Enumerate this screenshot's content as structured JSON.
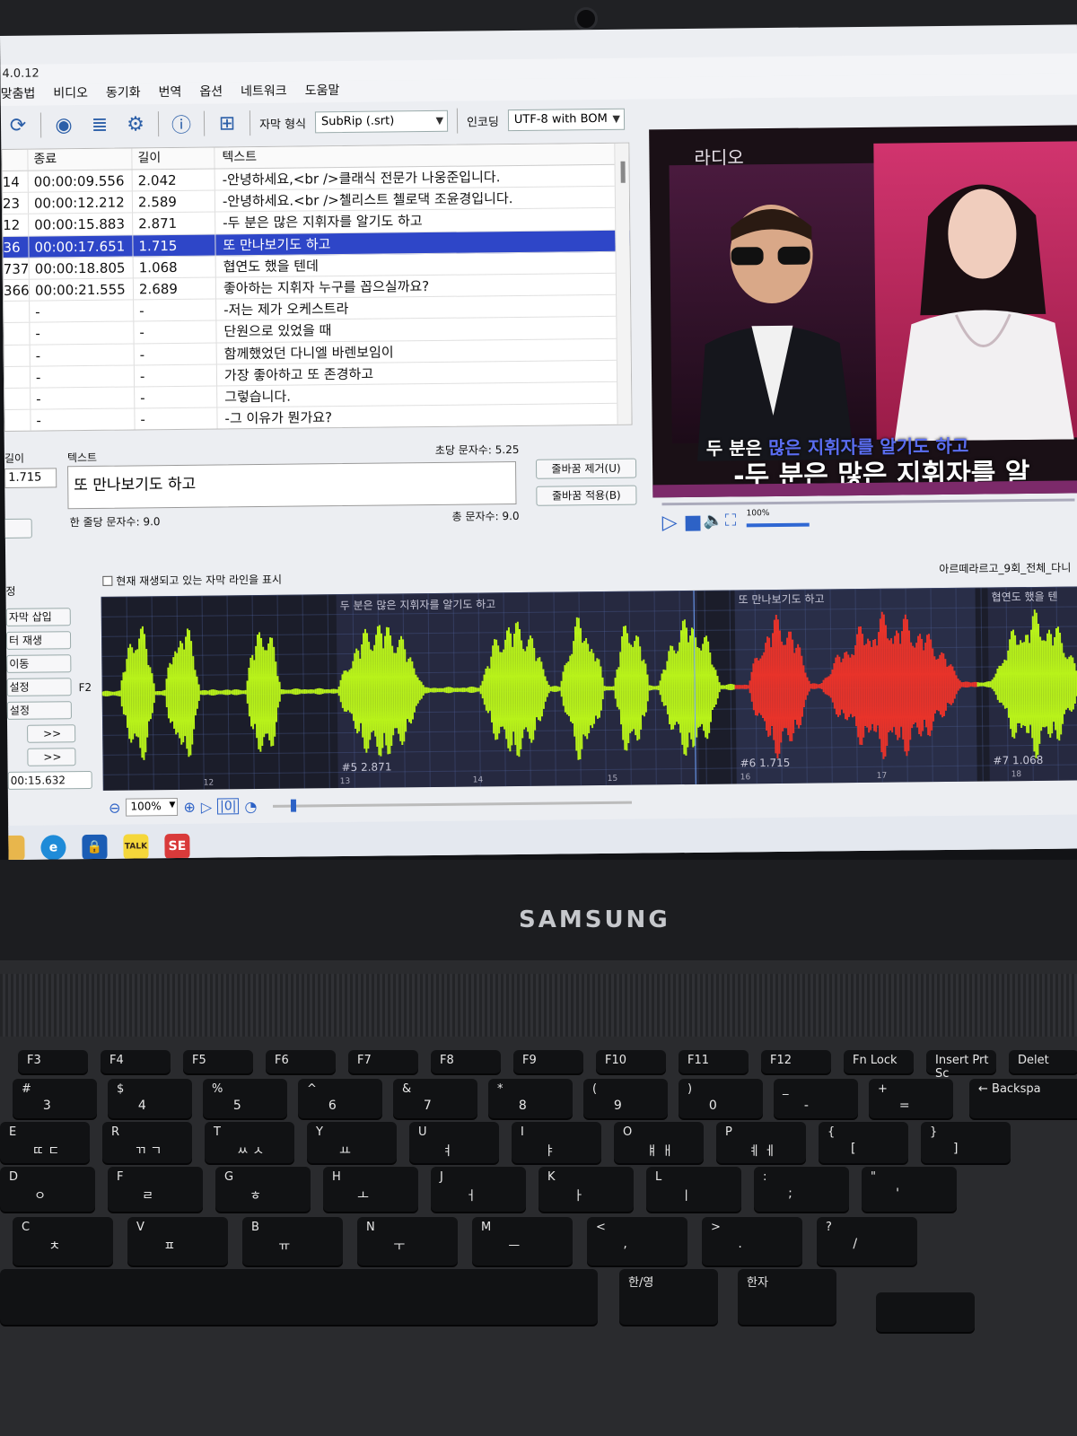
{
  "app": {
    "version": "4.0.12"
  },
  "menu": [
    "맞춤법",
    "비디오",
    "동기화",
    "번역",
    "옵션",
    "네트워크",
    "도움말"
  ],
  "toolbar": {
    "format_label": "자막 형식",
    "format_value": "SubRip (.srt)",
    "encoding_label": "인코딩",
    "encoding_value": "UTF-8 with BOM",
    "icons": [
      "refresh-icon",
      "eye-icon",
      "list-check-icon",
      "gear-icon",
      "help-icon",
      "layout-icon"
    ]
  },
  "table": {
    "headers": [
      "종료",
      "길이",
      "텍스트"
    ],
    "rows": [
      {
        "start": "14",
        "end": "00:00:09.556",
        "dur": "2.042",
        "text": "-안녕하세요,<br />클래식 전문가 나웅준입니다."
      },
      {
        "start": "23",
        "end": "00:00:12.212",
        "dur": "2.589",
        "text": "-안녕하세요.<br />첼리스트 첼로댁 조윤경입니다."
      },
      {
        "start": "12",
        "end": "00:00:15.883",
        "dur": "2.871",
        "text": "-두 분은 많은 지휘자를 알기도 하고"
      },
      {
        "start": "36",
        "end": "00:00:17.651",
        "dur": "1.715",
        "text": "또 만나보기도 하고",
        "selected": true
      },
      {
        "start": "737",
        "end": "00:00:18.805",
        "dur": "1.068",
        "text": "협연도 했을 텐데"
      },
      {
        "start": "366",
        "end": "00:00:21.555",
        "dur": "2.689",
        "text": "좋아하는 지휘자 누구를 꼽으실까요?"
      },
      {
        "start": "",
        "end": "-",
        "dur": "-",
        "text": "-저는 제가 오케스트라"
      },
      {
        "start": "",
        "end": "-",
        "dur": "-",
        "text": "단원으로 있었을 때"
      },
      {
        "start": "",
        "end": "-",
        "dur": "-",
        "text": "함께했었던 다니엘 바렌보임이"
      },
      {
        "start": "",
        "end": "-",
        "dur": "-",
        "text": "가장 좋아하고 또 존경하고"
      },
      {
        "start": "",
        "end": "-",
        "dur": "-",
        "text": "그렇습니다."
      },
      {
        "start": "",
        "end": "-",
        "dur": "-",
        "text": "-그 이유가 뭔가요?"
      }
    ]
  },
  "editor": {
    "duration_label": "길이",
    "duration_value": "1.715",
    "text_label": "텍스트",
    "cps": "초당 문자수: 5.25",
    "text_value": "또 만나보기도 하고",
    "line_chars": "한 줄당 문자수: 9.0",
    "total_chars": "총 문자수: 9.0",
    "remove_linebreak": "줄바꿈 제거(U)",
    "apply_linebreak": "줄바꿈 적용(B)",
    "next_btn": ">"
  },
  "video": {
    "logo": "라디오",
    "sub_top_a": "두 분은 ",
    "sub_top_b": "많은 지휘자를 알기도 하고",
    "sub_bottom": "-두 분은 많은 지휘자를 알",
    "volume": "100%",
    "volume_level": 1.0
  },
  "waveform": {
    "show_current_label": "현재 재생되고 있는 자막 라인을 표시",
    "filename": "아르떼라르고_9회_전체_다니",
    "seg1_text": "두 분은 많은 지휘자를 알기도 하고",
    "seg1_info": "#5  2.871",
    "seg2_text": "또 만나보기도 하고",
    "seg2_info": "#6  1.715",
    "seg3_text": "협연도 했을 텐",
    "seg3_info": "#7  1.068",
    "ticks": [
      "12",
      "13",
      "14",
      "15",
      "16",
      "17",
      "18"
    ],
    "zoom": "100%",
    "colors": {
      "normal": "#b8f21a",
      "selected": "#e8332a"
    }
  },
  "side": {
    "buttons": [
      "자막 삽입",
      "터 재생",
      "이동",
      "설정",
      "설정"
    ],
    "f2": "F2",
    "arrow": ">>",
    "time": "00:15.632"
  },
  "tabs_left": {
    "label": "정"
  },
  "taskbar": [
    "edge-icon",
    "lock-icon",
    "kakaotalk-icon",
    "subtitle-edit-icon"
  ],
  "laptop": {
    "brand": "SAMSUNG"
  },
  "keyboard": {
    "row1": [
      "F3",
      "F4",
      "F5",
      "F6",
      "F7",
      "F8",
      "F9",
      "F10",
      "F11",
      "F12",
      "Fn Lock",
      "Insert Prt Sc",
      "Delet"
    ],
    "row2": [
      [
        "#",
        "3"
      ],
      [
        "$",
        "4"
      ],
      [
        "%",
        "5"
      ],
      [
        "^",
        "6"
      ],
      [
        "&",
        "7"
      ],
      [
        "*",
        "8"
      ],
      [
        "(",
        "9"
      ],
      [
        ")",
        "0"
      ],
      [
        "_",
        "-"
      ],
      [
        "+",
        "="
      ]
    ],
    "backspace": "← Backspa",
    "row3": [
      [
        "E",
        "ㄸ ㄷ"
      ],
      [
        "R",
        "ㄲ ㄱ"
      ],
      [
        "T",
        "ㅆ ㅅ"
      ],
      [
        "Y",
        "ㅛ"
      ],
      [
        "U",
        "ㅕ"
      ],
      [
        "I",
        "ㅑ"
      ],
      [
        "O",
        "ㅒ ㅐ"
      ],
      [
        "P",
        "ㅖ ㅔ"
      ],
      [
        "{",
        "["
      ],
      [
        "}",
        "]"
      ]
    ],
    "row4": [
      [
        "D",
        "ㅇ"
      ],
      [
        "F",
        "ㄹ"
      ],
      [
        "G",
        "ㅎ"
      ],
      [
        "H",
        "ㅗ"
      ],
      [
        "J",
        "ㅓ"
      ],
      [
        "K",
        "ㅏ"
      ],
      [
        "L",
        "ㅣ"
      ],
      [
        ":",
        ";"
      ],
      [
        "\"",
        "'"
      ]
    ],
    "row5": [
      [
        "C",
        "ㅊ"
      ],
      [
        "V",
        "ㅍ"
      ],
      [
        "B",
        "ㅠ"
      ],
      [
        "N",
        "ㅜ"
      ],
      [
        "M",
        "ㅡ"
      ],
      [
        "<",
        ","
      ],
      [
        ">",
        "."
      ],
      [
        "?",
        "/"
      ]
    ],
    "han": "한/영",
    "hanja": "한자"
  }
}
